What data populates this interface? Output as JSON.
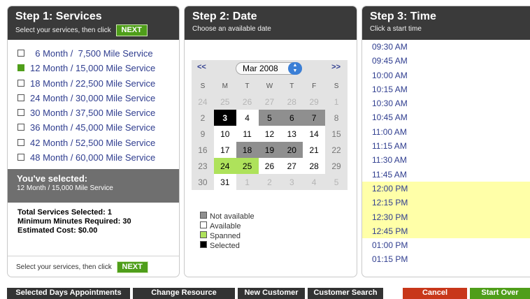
{
  "services": {
    "title": "Step 1: Services",
    "subtitle": "Select your services, then click",
    "next_label": "NEXT",
    "items": [
      {
        "label": "  6 Month /  7,500 Mile Service",
        "checked": false
      },
      {
        "label": "12 Month / 15,000 Mile Service",
        "checked": true
      },
      {
        "label": "18 Month / 22,500 Mile Service",
        "checked": false
      },
      {
        "label": "24 Month / 30,000 Mile Service",
        "checked": false
      },
      {
        "label": "30 Month / 37,500 Mile Service",
        "checked": false
      },
      {
        "label": "36 Month / 45,000 Mile Service",
        "checked": false
      },
      {
        "label": "42 Month / 52,500 Mile Service",
        "checked": false
      },
      {
        "label": "48 Month / 60,000 Mile Service",
        "checked": false
      }
    ],
    "selected_title": "You've selected:",
    "selected_value": "12 Month / 15,000 Mile Service",
    "totals": {
      "services_label": "Total Services Selected:",
      "services_value": "1",
      "minutes_label": "Minimum Minutes Required:",
      "minutes_value": "30",
      "cost_label": "Estimated Cost:",
      "cost_value": "$0.00"
    },
    "footer_text": "Select your services, then click",
    "footer_next": "NEXT"
  },
  "date": {
    "title": "Step 2: Date",
    "subtitle": "Choose an available date",
    "prev": "<<",
    "next": ">>",
    "month": "Mar 2008",
    "weekdays": [
      "S",
      "M",
      "T",
      "W",
      "T",
      "F",
      "S"
    ],
    "weeks": [
      [
        {
          "d": "24",
          "s": "dim"
        },
        {
          "d": "25",
          "s": "dim"
        },
        {
          "d": "26",
          "s": "dim"
        },
        {
          "d": "27",
          "s": "dim"
        },
        {
          "d": "28",
          "s": "dim"
        },
        {
          "d": "29",
          "s": "dim"
        },
        {
          "d": "1",
          "s": "dim"
        }
      ],
      [
        {
          "d": "2",
          "s": "edge"
        },
        {
          "d": "3",
          "s": "sel"
        },
        {
          "d": "4",
          "s": "avail"
        },
        {
          "d": "5",
          "s": "gray"
        },
        {
          "d": "6",
          "s": "gray"
        },
        {
          "d": "7",
          "s": "gray"
        },
        {
          "d": "8",
          "s": "edge"
        }
      ],
      [
        {
          "d": "9",
          "s": "edge"
        },
        {
          "d": "10",
          "s": "avail"
        },
        {
          "d": "11",
          "s": "avail"
        },
        {
          "d": "12",
          "s": "avail"
        },
        {
          "d": "13",
          "s": "avail"
        },
        {
          "d": "14",
          "s": "avail"
        },
        {
          "d": "15",
          "s": "edge"
        }
      ],
      [
        {
          "d": "16",
          "s": "edge"
        },
        {
          "d": "17",
          "s": "avail"
        },
        {
          "d": "18",
          "s": "gray"
        },
        {
          "d": "19",
          "s": "gray"
        },
        {
          "d": "20",
          "s": "gray"
        },
        {
          "d": "21",
          "s": "avail"
        },
        {
          "d": "22",
          "s": "edge"
        }
      ],
      [
        {
          "d": "23",
          "s": "edge"
        },
        {
          "d": "24",
          "s": "span"
        },
        {
          "d": "25",
          "s": "span"
        },
        {
          "d": "26",
          "s": "avail"
        },
        {
          "d": "27",
          "s": "avail"
        },
        {
          "d": "28",
          "s": "avail"
        },
        {
          "d": "29",
          "s": "edge"
        }
      ],
      [
        {
          "d": "30",
          "s": "edge"
        },
        {
          "d": "31",
          "s": "avail"
        },
        {
          "d": "1",
          "s": "dim"
        },
        {
          "d": "2",
          "s": "dim"
        },
        {
          "d": "3",
          "s": "dim"
        },
        {
          "d": "4",
          "s": "dim"
        },
        {
          "d": "5",
          "s": "dim"
        }
      ]
    ],
    "legend": [
      {
        "label": "Not available",
        "color": "#8f8f8f"
      },
      {
        "label": "Available",
        "color": "#ffffff"
      },
      {
        "label": "Spanned",
        "color": "#aee25b"
      },
      {
        "label": "Selected",
        "color": "#000000"
      }
    ]
  },
  "time": {
    "title": "Step 3: Time",
    "subtitle": "Click a start time",
    "slots": [
      {
        "t": "09:30 AM",
        "hl": false
      },
      {
        "t": "09:45 AM",
        "hl": false
      },
      {
        "t": "10:00 AM",
        "hl": false
      },
      {
        "t": "10:15 AM",
        "hl": false
      },
      {
        "t": "10:30 AM",
        "hl": false
      },
      {
        "t": "10:45 AM",
        "hl": false
      },
      {
        "t": "11:00 AM",
        "hl": false
      },
      {
        "t": "11:15 AM",
        "hl": false
      },
      {
        "t": "11:30 AM",
        "hl": false
      },
      {
        "t": "11:45 AM",
        "hl": false
      },
      {
        "t": "12:00 PM",
        "hl": true
      },
      {
        "t": "12:15 PM",
        "hl": true
      },
      {
        "t": "12:30 PM",
        "hl": true
      },
      {
        "t": "12:45 PM",
        "hl": true
      },
      {
        "t": "01:00 PM",
        "hl": false
      },
      {
        "t": "01:15 PM",
        "hl": false
      }
    ]
  },
  "footer": {
    "selected_days": "Selected Days Appointments",
    "change_resource": "Change Resource",
    "new_customer": "New Customer",
    "customer_search": "Customer Search",
    "cancel": "Cancel",
    "start_over": "Start Over"
  },
  "colors": {
    "cancel": "#c8371a",
    "start_over": "#4f9e1a",
    "dark": "#333333"
  }
}
